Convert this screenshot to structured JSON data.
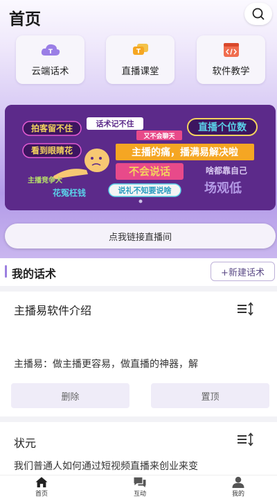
{
  "header": {
    "title": "首页"
  },
  "quick_cards": [
    {
      "label": "云端话术",
      "icon": "cloud-t-icon"
    },
    {
      "label": "直播课堂",
      "icon": "chat-bubble-t-icon"
    },
    {
      "label": "软件教学",
      "icon": "code-window-icon"
    }
  ],
  "banner": {
    "phrases": [
      "拍客留不住",
      "话术记不住",
      "又不会聊天",
      "直播个位数",
      "看到眼睛花",
      "主播的痛，播满易解决啦",
      "不会说话",
      "啥都靠自己",
      "主播竞争大",
      "花冤枉钱",
      "说礼不知要说啥",
      "场观低"
    ]
  },
  "link_button": {
    "label": "点我链接直播间"
  },
  "section": {
    "title": "我的话术",
    "new_button": "+新建话术"
  },
  "scripts": [
    {
      "title": "主播易软件介绍",
      "description": "主播易：做主播更容易，做直播的神器，解",
      "delete_label": "删除",
      "pin_label": "置顶"
    },
    {
      "title": "状元",
      "description": "我们普通人如何通过短视频直播来创业来变"
    }
  ],
  "tabbar": {
    "items": [
      {
        "label": "首页",
        "icon": "home-icon"
      },
      {
        "label": "互动",
        "icon": "chat-icon"
      },
      {
        "label": "我的",
        "icon": "user-icon"
      }
    ]
  },
  "colors": {
    "accent": "#9b7fe0",
    "banner_bg": "#5a2a86"
  }
}
